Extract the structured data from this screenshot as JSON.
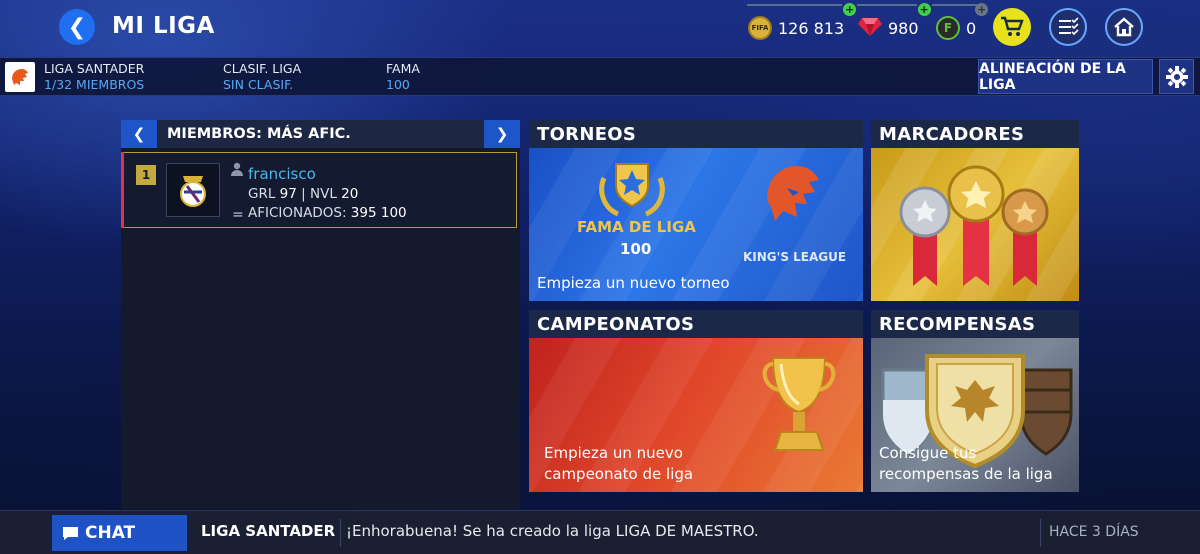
{
  "header": {
    "title": "MI LIGA",
    "coins": "126 813",
    "coins_icon_text": "FIFA",
    "gems": "980",
    "fifa_points": "0",
    "fifa_points_icon_text": "F"
  },
  "league": {
    "name_label": "LIGA SANTADER",
    "members": "1/32 MIEMBROS",
    "rank_label": "CLASIF. LIGA",
    "rank_value": "SIN CLASIF.",
    "fame_label": "FAMA",
    "fame_value": "100",
    "lineup_button": "ALINEACIÓN DE LA LIGA"
  },
  "members_panel": {
    "title": "MIEMBROS: MÁS AFIC.",
    "rows": [
      {
        "rank": "1",
        "name": "francisco",
        "grl_label": "GRL",
        "grl": "97",
        "nvl_label": "NVL",
        "nvl": "20",
        "fans_label": "AFICIONADOS:",
        "fans": "395 100"
      }
    ]
  },
  "tiles": {
    "torneos": {
      "title": "TORNEOS",
      "fame_label": "FAMA DE LIGA",
      "fame_value": "100",
      "kings_league": "KING'S LEAGUE",
      "desc": "Empieza un nuevo torneo"
    },
    "marcadores": {
      "title": "MARCADORES"
    },
    "campeonatos": {
      "title": "CAMPEONATOS",
      "desc_line1": "Empieza un nuevo",
      "desc_line2": "campeonato de liga"
    },
    "recompensas": {
      "title": "RECOMPENSAS",
      "desc_line1": "Consigue tus",
      "desc_line2": "recompensas de la liga"
    }
  },
  "chat": {
    "button": "CHAT",
    "league": "LIGA SANTADER",
    "message": "¡Enhorabuena! Se ha creado la liga LIGA  DE MAESTRO.",
    "time": "HACE 3 DÍAS"
  },
  "colors": {
    "accent_blue": "#1f6ff0",
    "link_blue": "#59a8f2",
    "gold": "#c4a93e",
    "cart_yellow": "#e8e21c"
  },
  "icons": [
    "back-icon",
    "coin-icon",
    "gem-icon",
    "fifa-points-icon",
    "cart-icon",
    "checklist-icon",
    "home-icon",
    "settings-gear-icon",
    "lion-crest-icon",
    "user-icon",
    "chat-bubble-icon",
    "laurel-star-icon",
    "medals-icon",
    "trophy-icon",
    "shields-icon"
  ]
}
